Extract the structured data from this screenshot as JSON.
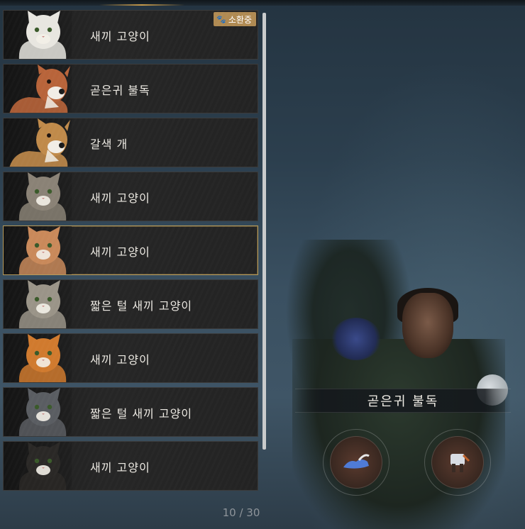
{
  "pets": [
    {
      "name": "새끼 고양이",
      "kind": "cat",
      "color": "#e8e6e0",
      "summoned": true
    },
    {
      "name": "곧은귀 불독",
      "kind": "dog",
      "color": "#b8643a"
    },
    {
      "name": "갈색 개",
      "kind": "dog",
      "color": "#c08a4a"
    },
    {
      "name": "새끼 고양이",
      "kind": "cat",
      "color": "#8a8276"
    },
    {
      "name": "새끼 고양이",
      "kind": "cat",
      "color": "#c9895a",
      "selected": true
    },
    {
      "name": "짧은 털 새끼 고양이",
      "kind": "cat",
      "color": "#9a9488"
    },
    {
      "name": "새끼 고양이",
      "kind": "cat",
      "color": "#d07a2e"
    },
    {
      "name": "짧은 털 새끼 고양이",
      "kind": "cat",
      "color": "#5a5d62"
    },
    {
      "name": "새끼 고양이",
      "kind": "cat",
      "color": "#2a2826"
    }
  ],
  "summon_badge": "소환중",
  "pagination": "10 / 30",
  "selected_pet_name": "곧은귀 불독",
  "slots": [
    {
      "icon": "hat-icon"
    },
    {
      "icon": "pet-armor-icon"
    }
  ]
}
